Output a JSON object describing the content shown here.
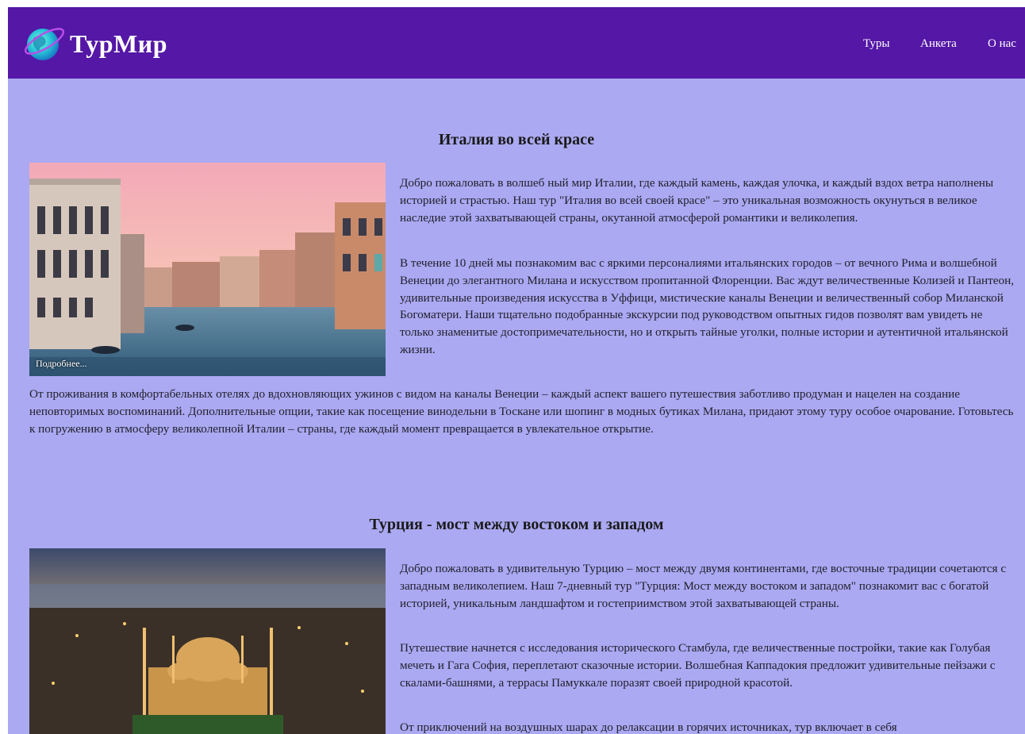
{
  "header": {
    "brand": "ТурМир",
    "nav": [
      "Туры",
      "Анкета",
      "О нас"
    ]
  },
  "tours": [
    {
      "title": "Италия во всей красе",
      "more_label": "Подробнее...",
      "paragraphs": [
        "Добро пожаловать в волшеб ный мир Италии, где каждый камень, каждая улочка, и каждый вздох ветра наполнены историей и страстью. Наш тур \"Италия во всей своей красе\" – это уникальная возможность окунуться в великое наследие этой захватывающей страны, окутанной атмосферой романтики и великолепия.",
        "В течение 10 дней мы познакомим вас с яркими персоналиями итальянских городов – от вечного Рима и волшебной Венеции до элегантного Милана и искусством пропитанной Флоренции. Вас ждут величественные Колизей и Пантеон, удивительные произведения искусства в Уффици, мистические каналы Венеции и величественный собор Миланской Богоматери. Наши тщательно подобранные экскурсии под руководством опытных гидов позволят вам увидеть не только знаменитые достопримечательности, но и открыть тайные уголки, полные истории и аутентичной итальянской жизни.",
        "От проживания в комфортабельных отелях до вдохновляющих ужинов с видом на каналы Венеции – каждый аспект вашего путешествия заботливо продуман и нацелен на создание неповторимых воспоминаний. Дополнительные опции, такие как посещение винодельни в Тоскане или шопинг в модных бутиках Милана, придают этому туру особое очарование. Готовьтесь к погружению в атмосферу великолепной Италии – страны, где каждый момент превращается в увлекательное открытие."
      ]
    },
    {
      "title": "Турция - мост между востоком и западом",
      "paragraphs": [
        "Добро пожаловать в удивительную Турцию – мост между двумя континентами, где восточные традиции сочетаются с западным великолепием. Наш 7-дневный тур \"Турция: Мост между востоком и западом\" познакомит вас с богатой историей, уникальным ландшафтом и гостеприимством этой захватывающей страны.",
        "Путешествие начнется с исследования исторического Стамбула, где величественные постройки, такие как Голубая мечеть и Гага София, переплетают сказочные истории. Волшебная Каппадокия предложит удивительные пейзажи с скалами-башнями, а террасы Памуккале поразят своей природной красотой.",
        "От приключений на воздушных шарах до релаксации в горячих источниках, тур включает в себя"
      ]
    }
  ],
  "colors": {
    "header_bg": "#5417a6",
    "page_bg": "#aba9f2",
    "text": "#1f1f2a"
  }
}
